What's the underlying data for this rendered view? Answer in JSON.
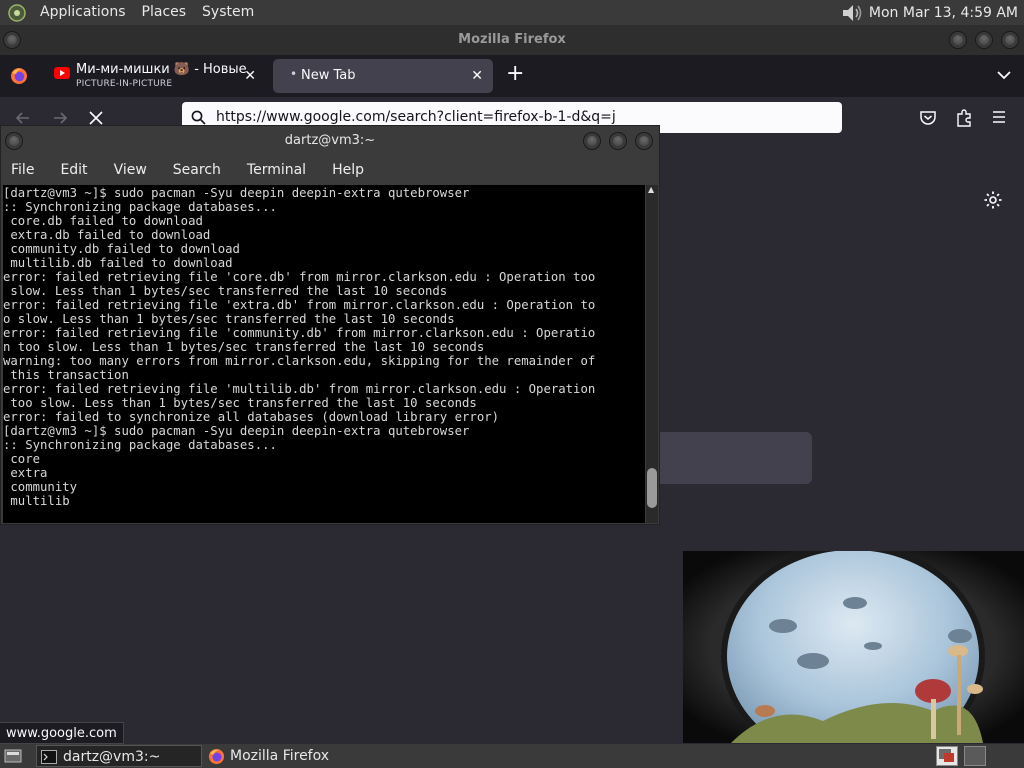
{
  "top_panel": {
    "menus": [
      "Applications",
      "Places",
      "System"
    ],
    "clock": "Mon Mar 13,  4:59 AM"
  },
  "firefox": {
    "window_title": "Mozilla Firefox",
    "tabs": [
      {
        "title": "Ми-ми-мишки 🐻 - Новые серии",
        "subtitle": "PICTURE-IN-PICTURE"
      },
      {
        "title": "New Tab"
      }
    ],
    "new_tab_symbol": "+",
    "url": "https://www.google.com/search?client=firefox-b-1-d&q=j",
    "status_text": "www.google.com"
  },
  "terminal": {
    "title": "dartz@vm3:~",
    "menus": [
      "File",
      "Edit",
      "View",
      "Search",
      "Terminal",
      "Help"
    ],
    "lines": [
      "[dartz@vm3 ~]$ sudo pacman -Syu deepin deepin-extra qutebrowser",
      ":: Synchronizing package databases...",
      " core.db failed to download",
      " extra.db failed to download",
      " community.db failed to download",
      " multilib.db failed to download",
      "error: failed retrieving file 'core.db' from mirror.clarkson.edu : Operation too",
      " slow. Less than 1 bytes/sec transferred the last 10 seconds",
      "error: failed retrieving file 'extra.db' from mirror.clarkson.edu : Operation to",
      "o slow. Less than 1 bytes/sec transferred the last 10 seconds",
      "error: failed retrieving file 'community.db' from mirror.clarkson.edu : Operatio",
      "n too slow. Less than 1 bytes/sec transferred the last 10 seconds",
      "warning: too many errors from mirror.clarkson.edu, skipping for the remainder of",
      " this transaction",
      "error: failed retrieving file 'multilib.db' from mirror.clarkson.edu : Operation",
      " too slow. Less than 1 bytes/sec transferred the last 10 seconds",
      "error: failed to synchronize all databases (download library error)",
      "[dartz@vm3 ~]$ sudo pacman -Syu deepin deepin-extra qutebrowser",
      ":: Synchronizing package databases...",
      " core",
      " extra",
      " community",
      " multilib"
    ]
  },
  "taskbar": {
    "items": [
      "dartz@vm3:~",
      "Mozilla Firefox"
    ]
  },
  "icons": {
    "gnome_logo": "gnome-foot-icon",
    "volume": "speaker-icon",
    "firefox": "firefox-icon",
    "youtube": "youtube-icon",
    "search": "search-icon",
    "pocket": "pocket-icon",
    "extensions": "puzzle-icon",
    "menu": "hamburger-icon",
    "settings": "gear-icon"
  },
  "colors": {
    "panel": "#3a3a3a",
    "firefox_dark": "#1c1b22",
    "firefox_toolbar": "#2b2a33",
    "active_tab": "#42414d",
    "terminal_bg": "#000000",
    "youtube_red": "#ff0000"
  }
}
